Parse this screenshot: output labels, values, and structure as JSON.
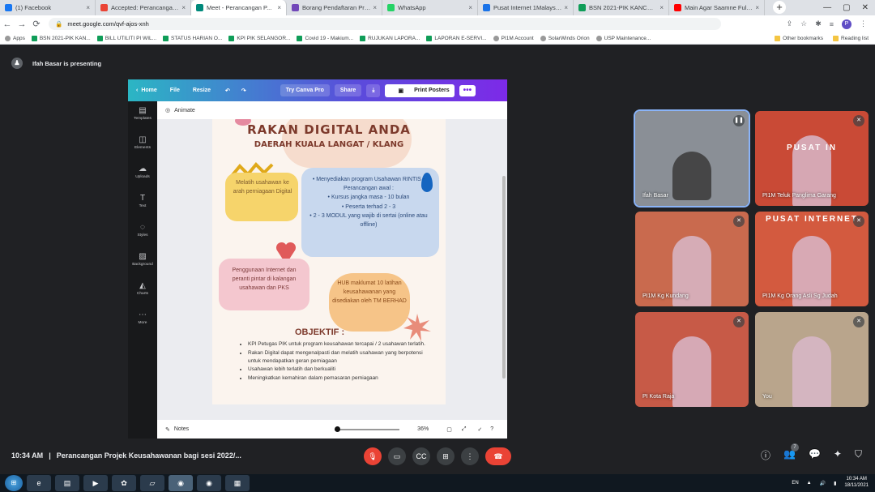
{
  "tabs": [
    {
      "title": "(1) Facebook",
      "color": "#1877f2"
    },
    {
      "title": "Accepted: Perancangan Pr...",
      "color": "#ea4335"
    },
    {
      "title": "Meet - Perancangan P...",
      "color": "#00897b"
    },
    {
      "title": "Borang Pendaftaran Progra...",
      "color": "#7248b9"
    },
    {
      "title": "WhatsApp",
      "color": "#25d366"
    },
    {
      "title": "Pusat Internet 1Malaysia - ...",
      "color": "#1a73e8"
    },
    {
      "title": "BSN 2021-PIK KANCHONG...",
      "color": "#0f9d58"
    },
    {
      "title": "Main Agar Saamne Full Vid...",
      "color": "#ff0000"
    }
  ],
  "address": {
    "url": "meet.google.com/qvf-ajos-xnh",
    "profile_initial": "P"
  },
  "bookmarks": [
    "Apps",
    "BSN 2021-PIK KAN...",
    "BILL UTILITI PI WIL...",
    "STATUS HARIAN O...",
    "KPI PIK SELANGOR...",
    "Covid 19 - Makium...",
    "RUJUKAN LAPORA...",
    "LAPORAN E-SERVI...",
    "PI1M Account",
    "SolarWinds Orion",
    "USP Maintenance..."
  ],
  "bookmarks_right": [
    "Other bookmarks",
    "Reading list"
  ],
  "presenter": "Ifah Basar is presenting",
  "canva": {
    "home": "Home",
    "file": "File",
    "resize": "Resize",
    "try_pro": "Try Canva Pro",
    "share": "Share",
    "print": "Print Posters",
    "animate": "Animate",
    "notes": "Notes",
    "zoom": "36%",
    "sidebar": [
      "Templates",
      "Elements",
      "Uploads",
      "Text",
      "Styles",
      "Background",
      "Charts",
      "More"
    ]
  },
  "poster": {
    "title": "RAKAN DIGITAL ANDA",
    "subtitle": "DAERAH KUALA LANGAT / KLANG",
    "box1": "Melatih usahawan ke arah perniagaan Digital",
    "box2_lines": [
      "Menyediakan program Usahawan RINTIS - Perancangan awal :",
      "Kursus jangka masa - 10 bulan",
      "Peserta terhad 2 - 3",
      "2 - 3 MODUL yang wajib di sertai (online atau offline)"
    ],
    "box3": "Penggunaan Internet dan peranti pintar di kalangan usahawan dan PKS",
    "box4": "HUB maklumat 10 latihan keusahawanan yang disediakan oleh TM BERHAD",
    "objektif_title": "OBJEKTIF :",
    "objektif_items": [
      "KPI Petugas PIK untuk program keusahawan tercapai / 2 usahawan terlatih.",
      "Rakan Digital dapat mengenalpasti dan melatih usahawan yang berpotensi untuk mendapatkan geran perniagaan",
      "Usahawan lebih terlatih dan berkualiti",
      "Meningkatkan kemahiran dalam pemasaran perniagaan"
    ]
  },
  "participants": [
    {
      "name": "Ifah Basar",
      "bg": "#8a8f96"
    },
    {
      "name": "PI1M Teluk Panglima Garang",
      "bg": "#c94a36"
    },
    {
      "name": "PI1M Kg Kundang",
      "bg": "#c96a4e"
    },
    {
      "name": "PI1M Kg Orang Asli Sg Judah",
      "bg": "#d35a3f"
    },
    {
      "name": "PI Kota Raja",
      "bg": "#c75a47"
    },
    {
      "name": "You",
      "bg": "#b9a58c"
    }
  ],
  "poster_labels": {
    "pusat": "PUSAT IN",
    "pusat2": "PUSAT INTERNET"
  },
  "meeting": {
    "time": "10:34 AM",
    "separator": "|",
    "title": "Perancangan Projek Keusahawanan bagi sesi 2022/...",
    "people_count": "7"
  },
  "taskbar": {
    "lang": "EN",
    "time": "10:34 AM",
    "date": "18/11/2021"
  }
}
